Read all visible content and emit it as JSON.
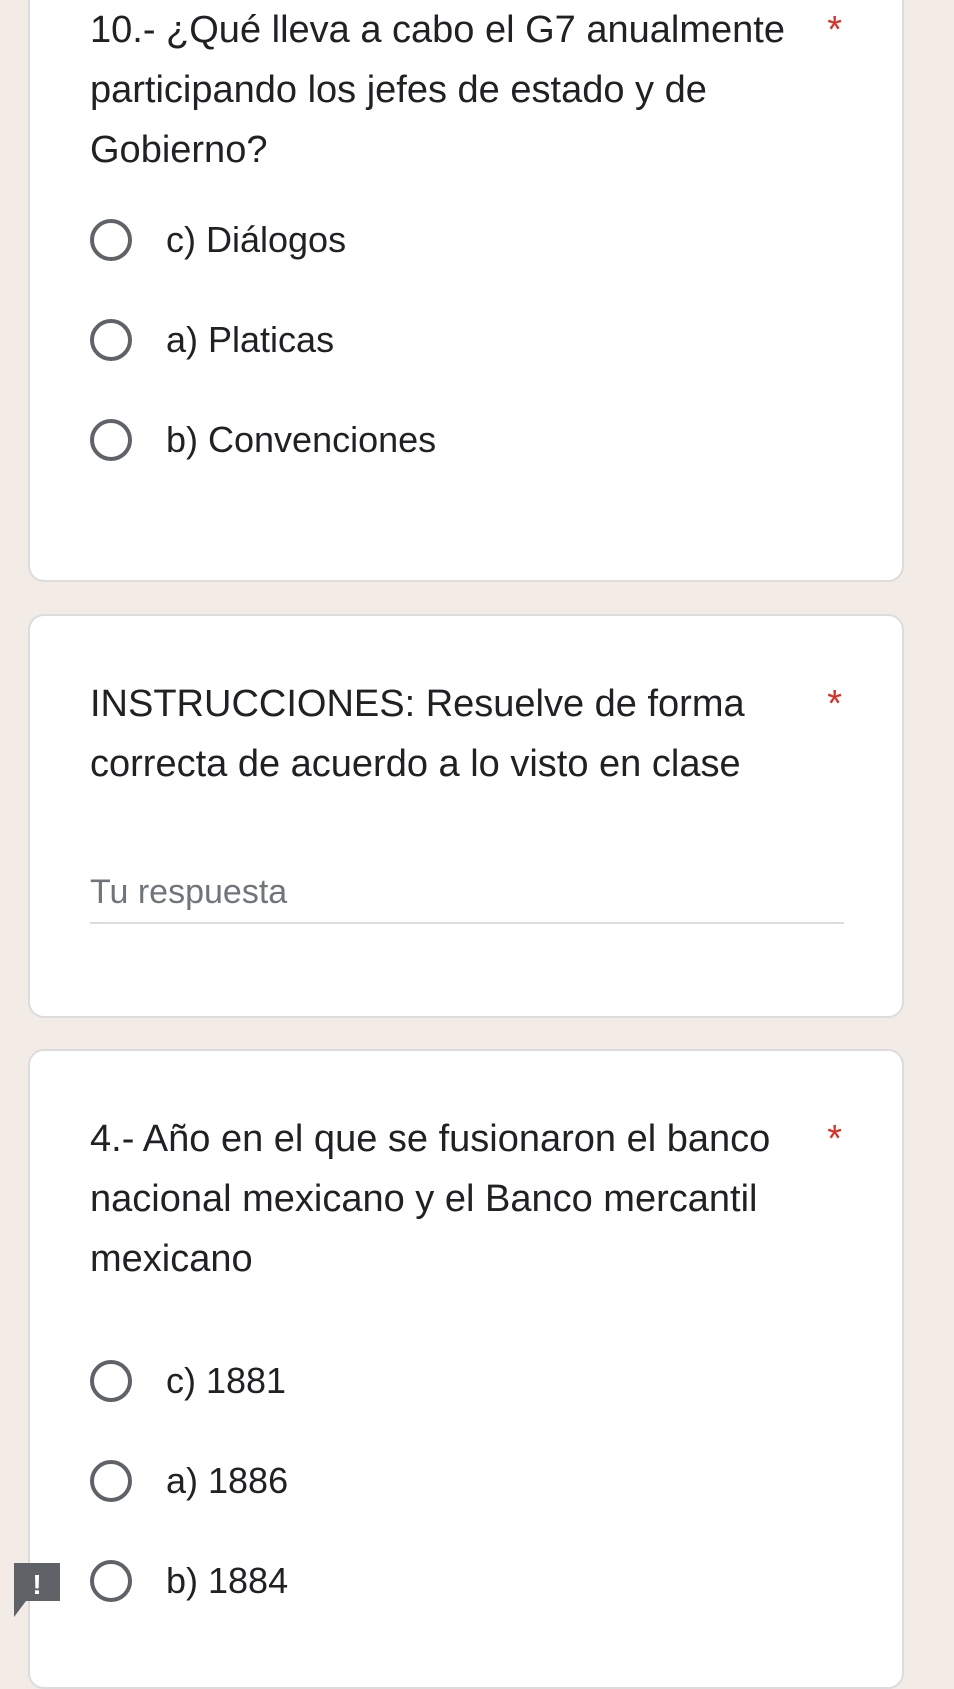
{
  "question10": {
    "title": "10.- ¿Qué lleva a cabo el G7 anualmente participando los jefes de estado y de Gobierno?",
    "required_mark": "*",
    "options": [
      {
        "label": "c) Diálogos"
      },
      {
        "label": "a) Platicas"
      },
      {
        "label": "b) Convenciones"
      }
    ]
  },
  "instructions": {
    "title": "INSTRUCCIONES: Resuelve de forma correcta de acuerdo a lo visto en clase",
    "required_mark": "*",
    "answer_placeholder": "Tu respuesta"
  },
  "question4": {
    "title": "4.- Año en el que se fusionaron el banco nacional mexicano y el Banco mercantil mexicano",
    "required_mark": "*",
    "options": [
      {
        "label": "c) 1881"
      },
      {
        "label": "a) 1886"
      },
      {
        "label": "b) 1884"
      }
    ]
  },
  "error_badge": {
    "symbol": "!",
    "icon": "report-icon",
    "color": "#5f6368"
  }
}
